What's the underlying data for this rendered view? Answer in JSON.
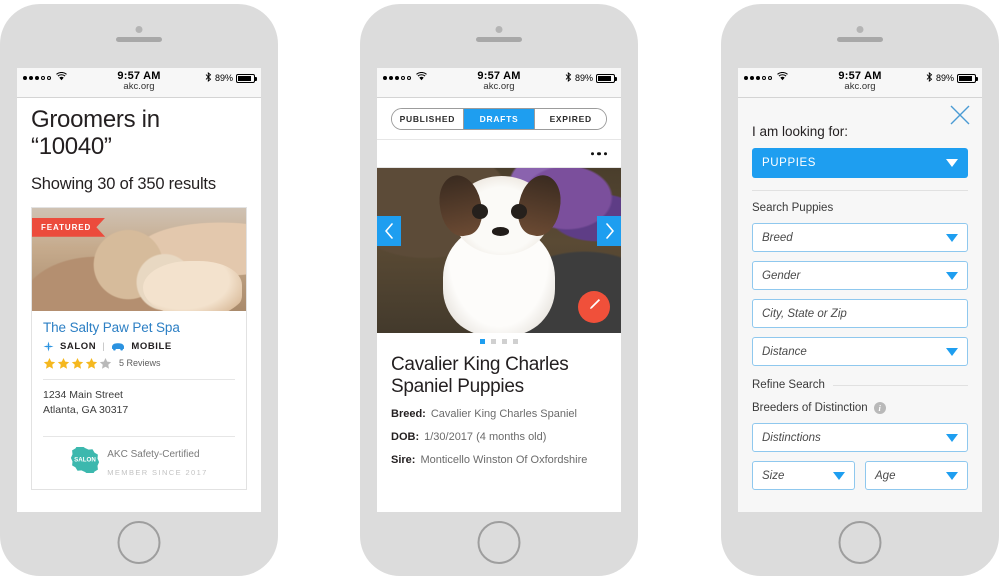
{
  "status_bar": {
    "time": "9:57 AM",
    "url": "akc.org",
    "battery": "89%",
    "signal_dots_filled": 3,
    "signal_dots_empty": 2
  },
  "phone1": {
    "title_line1": "Groomers in",
    "title_line2": "“10040”",
    "results": "Showing 30 of 350 results",
    "card": {
      "featured_badge": "FEATURED",
      "business_name": "The Salty Paw Pet Spa",
      "tag_salon": "SALON",
      "tag_sep": "|",
      "tag_mobile": "MOBILE",
      "rating_filled": 4,
      "rating_total": 5,
      "reviews": "5 Reviews",
      "address_line1": "1234 Main Street",
      "address_line2": "Atlanta, GA 30317",
      "badge_seal_text": "SALON",
      "badge_title": "AKC Safety-Certified",
      "badge_sub": "MEMBER SINCE 2017"
    }
  },
  "phone2": {
    "tabs": [
      {
        "label": "PUBLISHED",
        "active": false
      },
      {
        "label": "DRAFTS",
        "active": true
      },
      {
        "label": "EXPIRED",
        "active": false
      }
    ],
    "overflow_menu": "•••",
    "carousel": {
      "prev": "‹",
      "next": "›",
      "edit_icon": "pencil-icon",
      "dots_total": 4,
      "dot_active_index": 0
    },
    "title": "Cavalier King Charles Spaniel Puppies",
    "details": [
      {
        "label": "Breed:",
        "value": "Cavalier King Charles Spaniel"
      },
      {
        "label": "DOB:",
        "value": "1/30/2017 (4 months old)"
      },
      {
        "label": "Sire:",
        "value": "Monticello Winston Of Oxfordshire"
      }
    ]
  },
  "phone3": {
    "close_icon": "close-icon",
    "heading": "I am looking for:",
    "primary_select": "PUPPIES",
    "section_label": "Search Puppies",
    "fields": [
      {
        "placeholder": "Breed",
        "type": "select"
      },
      {
        "placeholder": "Gender",
        "type": "select"
      },
      {
        "placeholder": "City, State or Zip",
        "type": "text"
      },
      {
        "placeholder": "Distance",
        "type": "select"
      }
    ],
    "refine_label": "Refine Search",
    "distinction_label": "Breeders of Distinction",
    "distinction_select": "Distinctions",
    "size_select": "Size",
    "age_select": "Age"
  },
  "colors": {
    "accent_blue": "#1e9ef0",
    "link_blue": "#2c7fc4",
    "featured_red": "#ec4b3c",
    "fab_red": "#f0503a",
    "teal": "#3cb8ae",
    "star_gold": "#f5b81f"
  }
}
